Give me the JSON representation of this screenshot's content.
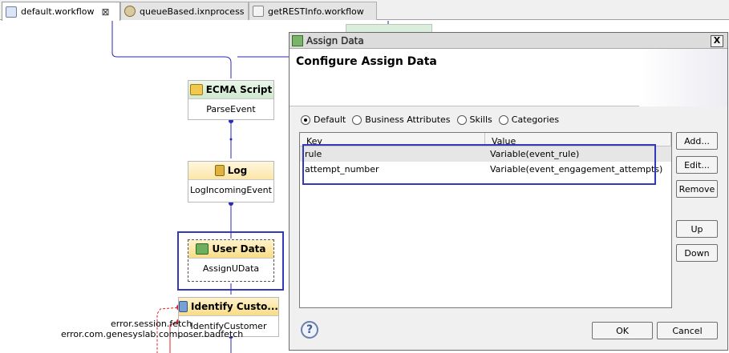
{
  "tabs": [
    {
      "label": "default.workflow",
      "active": true,
      "close": "⊠"
    },
    {
      "label": "queueBased.ixnprocess",
      "active": false
    },
    {
      "label": "getRESTInfo.workflow",
      "active": false
    }
  ],
  "nodes": {
    "ecma": {
      "title": "ECMA Script",
      "subtitle": "ParseEvent"
    },
    "log": {
      "title": "Log",
      "subtitle": "LogIncomingEvent"
    },
    "user_data": {
      "title": "User Data",
      "subtitle": "AssignUData"
    },
    "identify": {
      "title": "Identify Custo...",
      "subtitle": "IdentifyCustomer"
    }
  },
  "errors": [
    "error.session.fetch",
    "error.com.genesyslab.composer.badfetch"
  ],
  "dialog": {
    "title": "Assign Data",
    "close": "X",
    "heading": "Configure Assign Data",
    "radios": [
      {
        "label": "Default",
        "selected": true
      },
      {
        "label": "Business Attributes",
        "selected": false
      },
      {
        "label": "Skills",
        "selected": false
      },
      {
        "label": "Categories",
        "selected": false
      }
    ],
    "columns": [
      "Key",
      "Value"
    ],
    "rows": [
      {
        "key": "rule",
        "value": "Variable(event_rule)"
      },
      {
        "key": "attempt_number",
        "value": "Variable(event_engagement_attempts)"
      }
    ],
    "buttons": {
      "add": "Add...",
      "edit": "Edit...",
      "remove": "Remove",
      "up": "Up",
      "down": "Down",
      "ok": "OK",
      "cancel": "Cancel"
    },
    "help": "?"
  },
  "colors": {
    "highlight": "#3339b8",
    "connector": "#2a2ab8",
    "error_connector": "#e02020"
  }
}
